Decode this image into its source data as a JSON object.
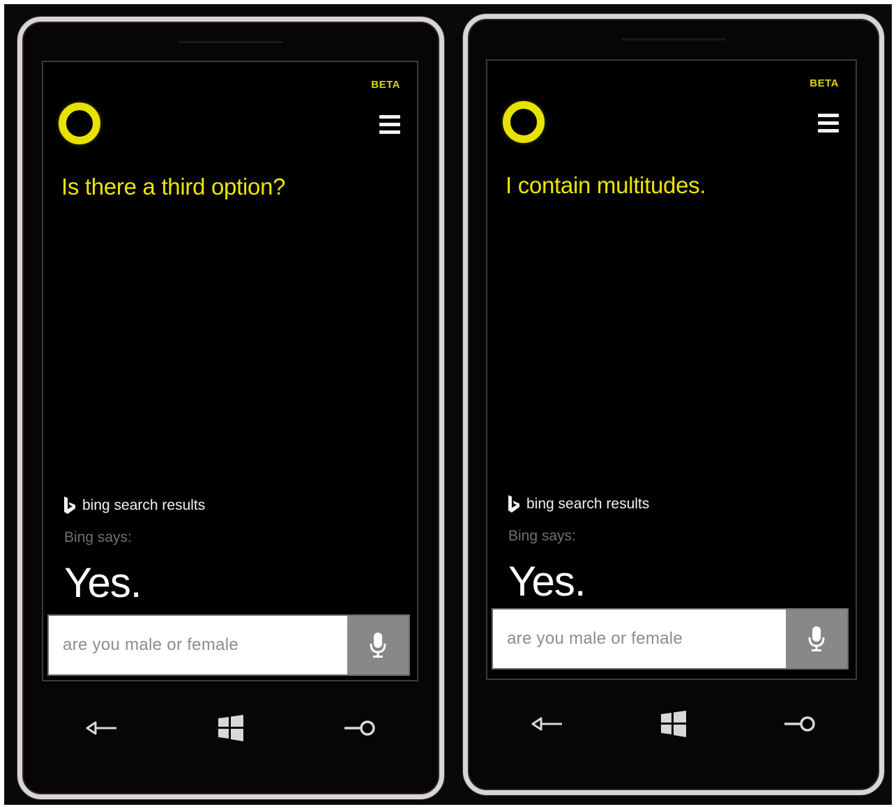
{
  "phones": [
    {
      "badge": "BETA",
      "question": "Is there a third option?",
      "bing_label": "bing search results",
      "bing_says": "Bing says:",
      "answer": "Yes.",
      "search_value": "are you male or female"
    },
    {
      "badge": "BETA",
      "question": "I contain multitudes.",
      "bing_label": "bing search results",
      "bing_says": "Bing says:",
      "answer": "Yes.",
      "search_value": "are you male or female"
    }
  ],
  "icons": {
    "assistant": "cortana-ring-icon",
    "menu": "hamburger-menu-icon",
    "brand": "bing-logo-icon",
    "mic": "microphone-icon",
    "back": "back-arrow-icon",
    "home": "windows-logo-icon",
    "search": "search-key-icon"
  },
  "colors": {
    "accent": "#ede600",
    "background": "#000000",
    "mic_button": "#888888",
    "text_primary": "#ffffff",
    "text_muted": "#707070"
  }
}
